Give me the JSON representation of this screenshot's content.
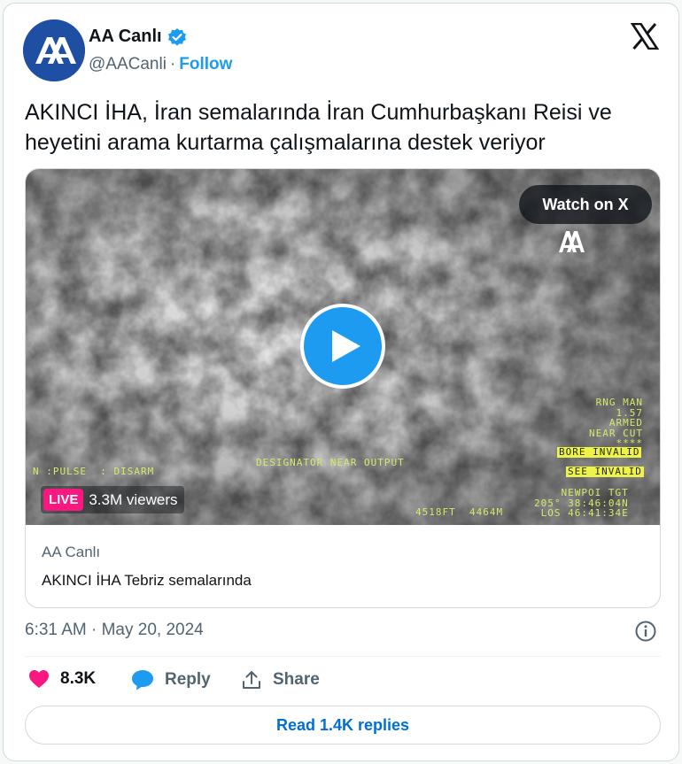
{
  "author": {
    "name": "AA Canlı",
    "handle": "@AACanli",
    "separator": "·",
    "follow_label": "Follow",
    "avatar_icon": "aa-logo-icon",
    "verified_icon": "verified-badge-icon"
  },
  "tweet": {
    "text": "AKINCI İHA, İran semalarında İran Cumhurbaşkanı Reisi ve heyetini arama kurtarma çalışmalarına destek veriyor",
    "timestamp": "6:31 AM · May 20, 2024"
  },
  "media": {
    "watch_label": "Watch on X",
    "live_badge": "LIVE",
    "viewers": "3.3M viewers",
    "hud": {
      "right_block": "RNG MAN\n1.57\nARMED\nNEAR CUT\n****",
      "bore": "BORE INVALID",
      "see": "SEE INVALID",
      "target_block": "NEWPOI TGT\n205° 38:46:04N\nLOS 46:41:34E",
      "left_mode": "N :PULSE  : DISARM",
      "center_mode": "DESIGNATOR NEAR OUTPUT",
      "bottom_center": "4518FT  4464M"
    },
    "preview_name": "AA Canlı",
    "preview_title": "AKINCI İHA Tebriz semalarında"
  },
  "actions": {
    "likes": "8.3K",
    "reply_label": "Reply",
    "share_label": "Share"
  },
  "read_replies_label": "Read 1.4K replies",
  "colors": {
    "accent": "#1d9bf0",
    "like": "#f91880",
    "link": "#006fd6",
    "muted": "#536471",
    "avatar_bg": "#1f4fa3"
  }
}
